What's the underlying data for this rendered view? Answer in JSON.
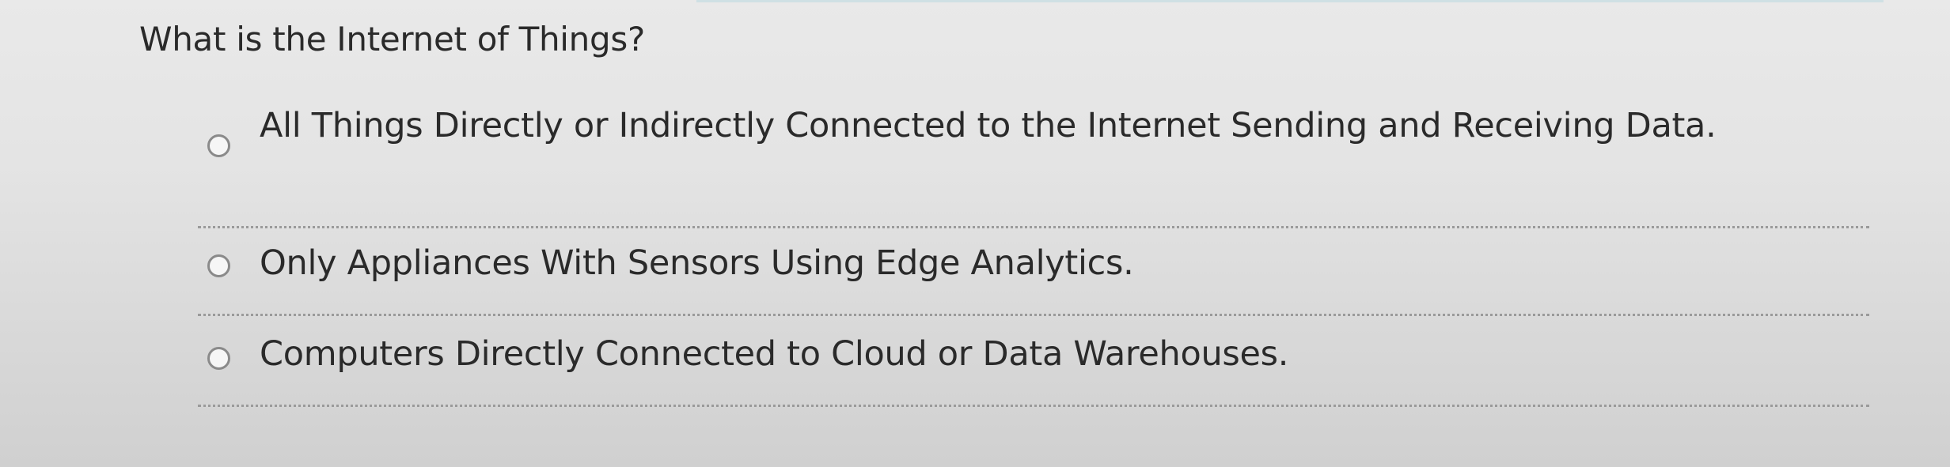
{
  "question": {
    "text": "What is the Internet of Things?"
  },
  "options": [
    {
      "label": "All Things Directly or Indirectly Connected to the Internet Sending and Receiving Data.",
      "selected": false
    },
    {
      "label": "Only Appliances With Sensors Using Edge Analytics.",
      "selected": false
    },
    {
      "label": "Computers Directly Connected to Cloud or Data Warehouses.",
      "selected": false
    }
  ]
}
